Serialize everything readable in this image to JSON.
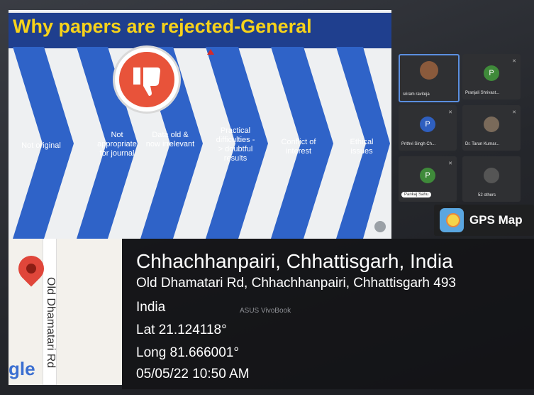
{
  "slide": {
    "title": "Why papers are rejected-General",
    "reasons": [
      "Not original",
      "Not appropriate for journal",
      "Data old & now irrelevant",
      "Practical difficulties - > doubtful results",
      "Conflict of interest",
      "Ethical issues"
    ]
  },
  "participants": [
    {
      "name": "sriram raviteja",
      "initial": "",
      "color": "#8a5a3c"
    },
    {
      "name": "Pranjali Shrivast...",
      "initial": "P",
      "color": "#3f8a3a"
    },
    {
      "name": "Prithvi Singh Ch...",
      "initial": "P",
      "color": "#2f5fbf"
    },
    {
      "name": "Dr. Tarun Kumar...",
      "initial": "",
      "color": "#7a6a5a"
    },
    {
      "name": "Pankaj Sahu",
      "initial": "P",
      "color": "#3f8a3a"
    },
    {
      "name": "52 others",
      "initial": "",
      "color": "#555"
    }
  ],
  "gps": {
    "app_label": "GPS Map",
    "place": "Chhachhanpairi, Chhattisgarh, India",
    "address": "Old Dhamatari Rd, Chhachhanpairi, Chhattisgarh 493",
    "country": "India",
    "lat": "Lat 21.124118°",
    "long": "Long 81.666001°",
    "datetime": "05/05/22 10:50 AM"
  },
  "map": {
    "road_label": "Old Dhamatari Rd",
    "brand": "gle"
  },
  "laptop_brand": "ASUS VivoBook",
  "colors": {
    "slide_title_bar": "#1f3f8e",
    "slide_title_text": "#f7d21a",
    "chevron": "#2f63c8",
    "thumbs_down": "#e8533a"
  }
}
